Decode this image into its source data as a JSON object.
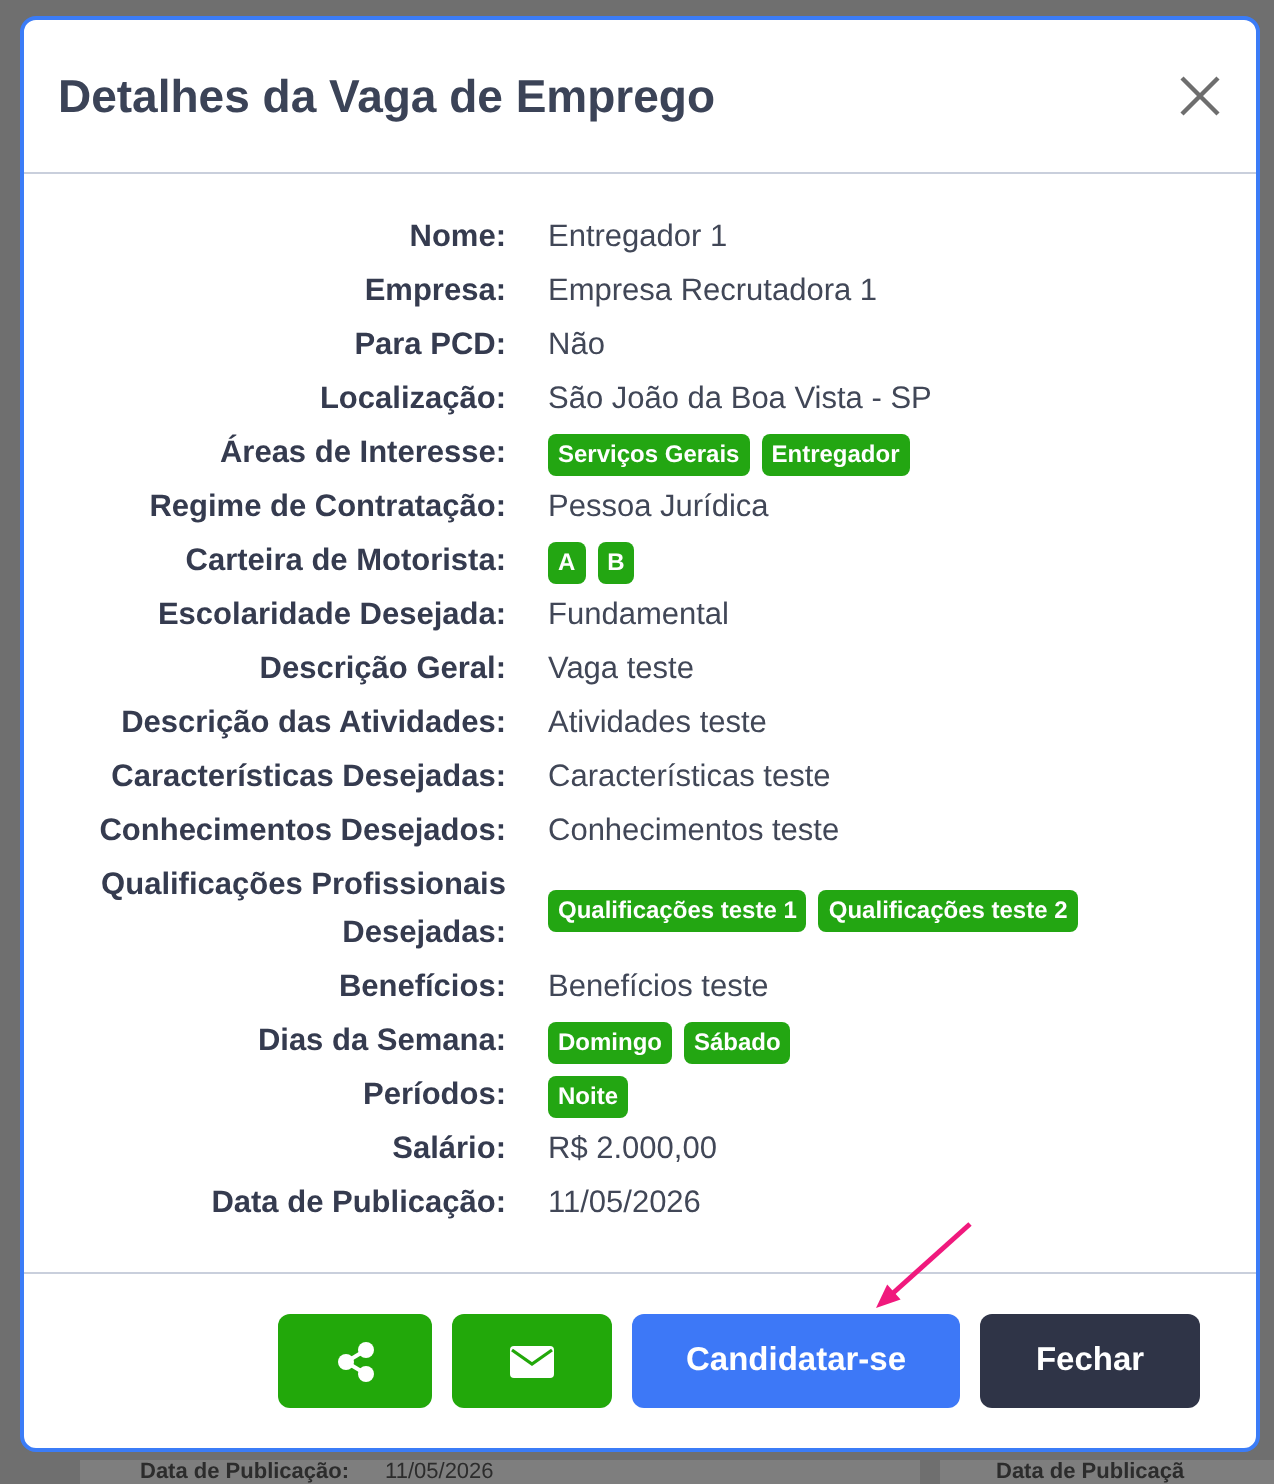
{
  "modal": {
    "title": "Detalhes da Vaga de Emprego",
    "fields": [
      {
        "label": "Nome:",
        "kind": "text",
        "value": "Entregador 1"
      },
      {
        "label": "Empresa:",
        "kind": "text",
        "value": "Empresa Recrutadora 1"
      },
      {
        "label": "Para PCD:",
        "kind": "text",
        "value": "Não"
      },
      {
        "label": "Localização:",
        "kind": "text",
        "value": "São João da Boa Vista - SP"
      },
      {
        "label": "Áreas de Interesse:",
        "kind": "tags",
        "tags": [
          "Serviços Gerais",
          "Entregador"
        ]
      },
      {
        "label": "Regime de Contratação:",
        "kind": "text",
        "value": "Pessoa Jurídica"
      },
      {
        "label": "Carteira de Motorista:",
        "kind": "tags",
        "tags": [
          "A",
          "B"
        ]
      },
      {
        "label": "Escolaridade Desejada:",
        "kind": "text",
        "value": "Fundamental"
      },
      {
        "label": "Descrição Geral:",
        "kind": "text",
        "value": "Vaga teste"
      },
      {
        "label": "Descrição das Atividades:",
        "kind": "text",
        "value": "Atividades teste"
      },
      {
        "label": "Características Desejadas:",
        "kind": "text",
        "value": "Características teste"
      },
      {
        "label": "Conhecimentos Desejados:",
        "kind": "text",
        "value": "Conhecimentos teste"
      },
      {
        "label": "Qualificações Profissionais Desejadas:",
        "kind": "tags",
        "tags": [
          "Qualificações teste 1",
          "Qualificações teste 2"
        ]
      },
      {
        "label": "Benefícios:",
        "kind": "text",
        "value": "Benefícios teste"
      },
      {
        "label": "Dias da Semana:",
        "kind": "tags",
        "tags": [
          "Domingo",
          "Sábado"
        ]
      },
      {
        "label": "Períodos:",
        "kind": "tags",
        "tags": [
          "Noite"
        ]
      },
      {
        "label": "Salário:",
        "kind": "text",
        "value": "R$ 2.000,00"
      },
      {
        "label": "Data de Publicação:",
        "kind": "text",
        "value": "11/05/2026"
      }
    ],
    "buttons": [
      {
        "kind": "share"
      },
      {
        "kind": "email"
      },
      {
        "kind": "primary",
        "label": "Candidatar-se"
      },
      {
        "kind": "dark",
        "label": "Fechar"
      }
    ]
  },
  "background_cards": [
    {
      "label": "Data de Publicação:",
      "value": "11/05/2026"
    },
    {
      "label": "Data de Publicaçã"
    }
  ]
}
